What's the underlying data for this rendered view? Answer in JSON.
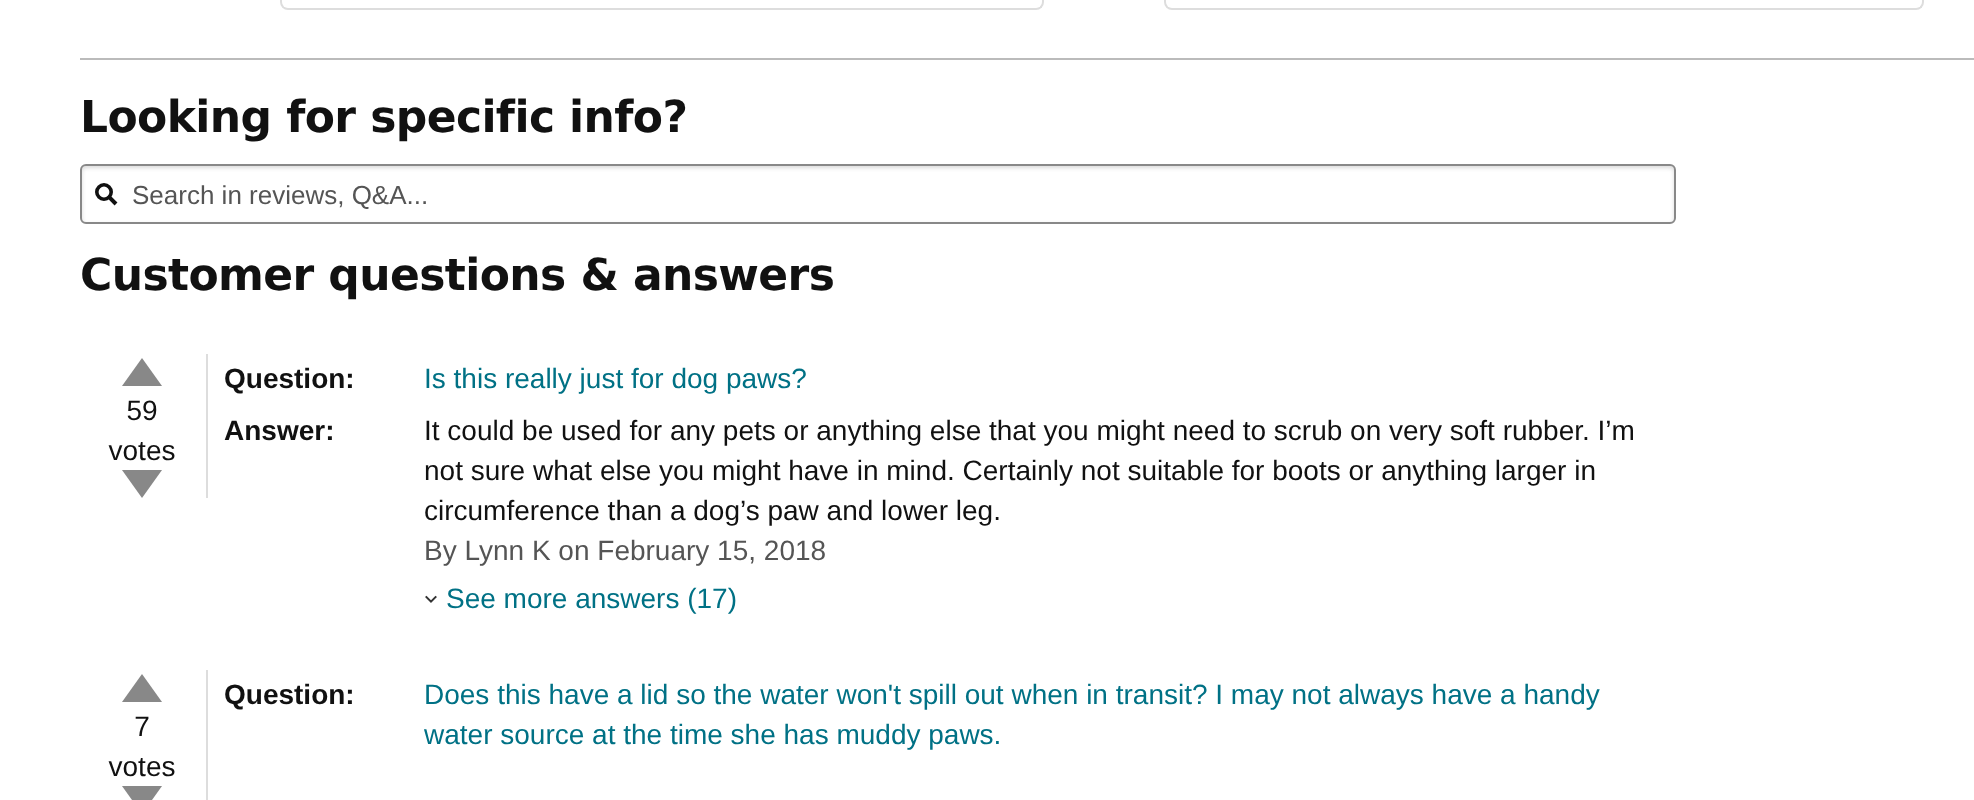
{
  "search_heading": "Looking for specific info?",
  "search": {
    "placeholder": "Search in reviews, Q&A..."
  },
  "qa_heading": "Customer questions & answers",
  "questions": [
    {
      "votes": "59",
      "votes_label": "votes",
      "question_label": "Question:",
      "question": "Is this really just for dog paws?",
      "answer_label": "Answer:",
      "answer": "It could be used for any pets or anything else that you might need to scrub on very soft rubber. I’m not sure what else you might have in mind. Certainly not suitable for boots or anything larger in circumference than a dog’s paw and lower leg.",
      "byline": "By Lynn K on February 15, 2018",
      "more_link": "See more answers (17)"
    },
    {
      "votes": "7",
      "votes_label": "votes",
      "question_label": "Question:",
      "question": "Does this have a lid so the water won't spill out when in transit? I may not always have a handy water source at the time she has muddy paws."
    }
  ]
}
